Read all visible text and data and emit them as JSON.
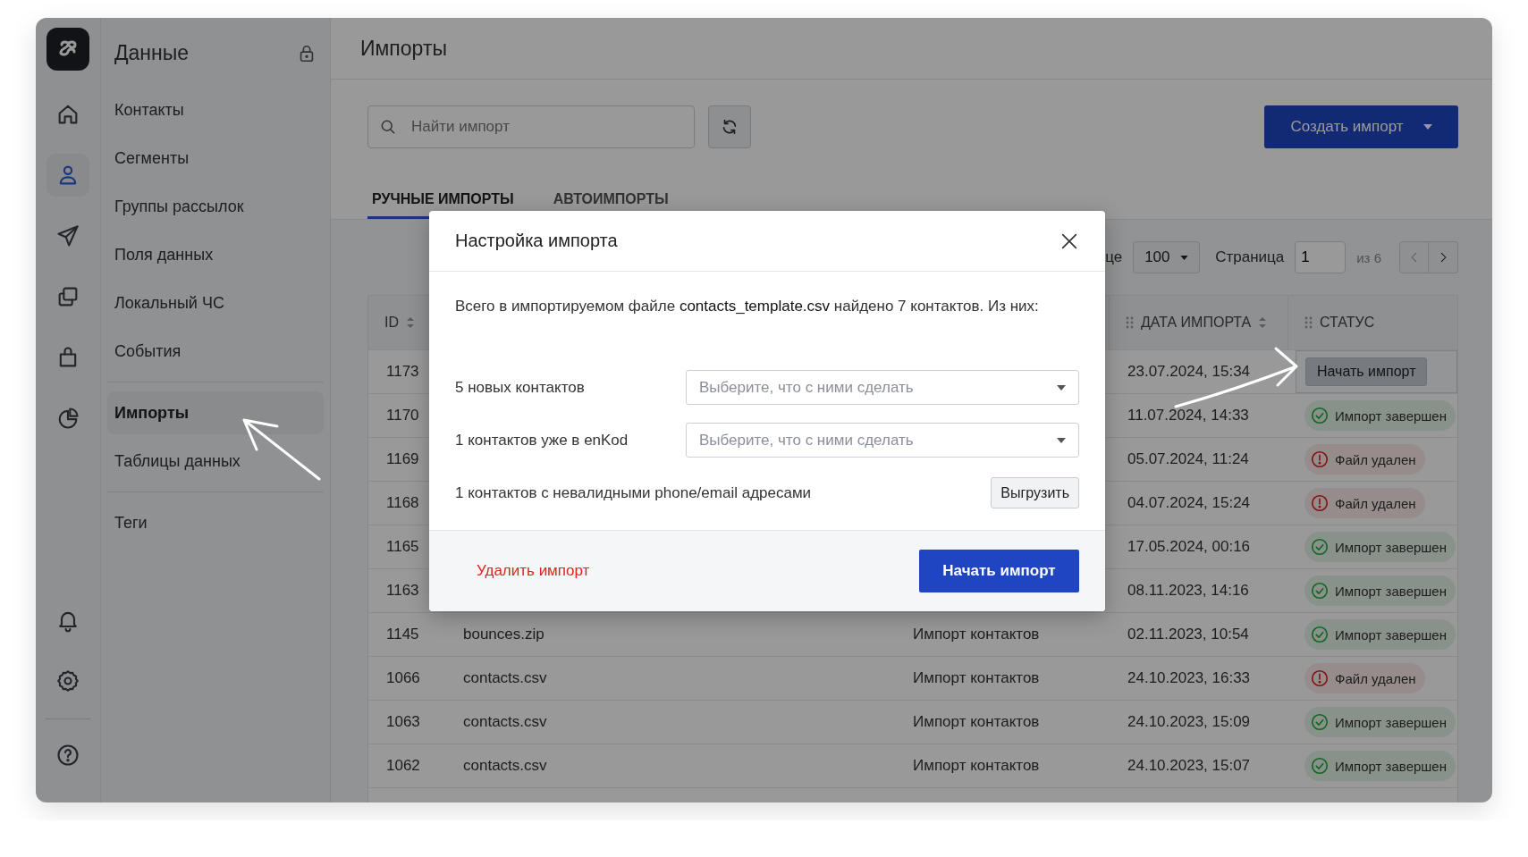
{
  "rail": {
    "top": [
      {
        "kind": "home",
        "selected": false
      },
      {
        "kind": "person",
        "selected": true
      },
      {
        "kind": "send",
        "selected": false
      },
      {
        "kind": "copy",
        "selected": false
      },
      {
        "kind": "bag",
        "selected": false
      },
      {
        "kind": "pie",
        "selected": false
      }
    ],
    "bottom": [
      {
        "kind": "bell",
        "selected": false
      },
      {
        "kind": "gear",
        "selected": false
      },
      {
        "kind": "help",
        "selected": false
      }
    ]
  },
  "sidebar": {
    "title": "Данные",
    "locked": true,
    "groups": [
      [
        {
          "label": "Контакты",
          "selected": false
        },
        {
          "label": "Сегменты",
          "selected": false
        },
        {
          "label": "Группы рассылок",
          "selected": false
        },
        {
          "label": "Поля данных",
          "selected": false
        },
        {
          "label": "Локальный ЧС",
          "selected": false
        },
        {
          "label": "События",
          "selected": false
        }
      ],
      [
        {
          "label": "Импорты",
          "selected": true
        },
        {
          "label": "Таблицы данных",
          "selected": false
        }
      ],
      [
        {
          "label": "Теги",
          "selected": false
        }
      ]
    ]
  },
  "page": {
    "title": "Импорты"
  },
  "toolbar": {
    "search": {
      "placeholder": "Найти импорт"
    },
    "create_button": "Создать импорт"
  },
  "tabs": [
    {
      "label": "РУЧНЫЕ ИМПОРТЫ",
      "selected": true
    },
    {
      "label": "АВТОИМПОРТЫ",
      "selected": false
    }
  ],
  "pagination": {
    "per_page_label": "це",
    "per_page": "100",
    "page_label": "Страница",
    "page": "1",
    "total": "из 6"
  },
  "table": {
    "columns": [
      {
        "label": "ID",
        "sortable": true,
        "draggable": false
      },
      {},
      {},
      {
        "label": "ДАТА ИМПОРТА",
        "sortable": true,
        "draggable": true
      },
      {
        "label": "СТАТУС",
        "sortable": false,
        "draggable": true
      }
    ],
    "rows": [
      {
        "id": "1173",
        "date": "23.07.2024, 15:34",
        "status": {
          "kind": "action",
          "label": "Начать импорт"
        }
      },
      {
        "id": "1170",
        "date": "11.07.2024, 14:33",
        "status": {
          "kind": "done",
          "label": "Импорт завершен"
        }
      },
      {
        "id": "1169",
        "date": "05.07.2024, 11:24",
        "status": {
          "kind": "deleted",
          "label": "Файл удален"
        }
      },
      {
        "id": "1168",
        "date": "04.07.2024, 15:24",
        "status": {
          "kind": "deleted",
          "label": "Файл удален"
        }
      },
      {
        "id": "1165",
        "date": "17.05.2024, 00:16",
        "status": {
          "kind": "done",
          "label": "Импорт завершен"
        }
      },
      {
        "id": "1163",
        "date": "08.11.2023, 14:16",
        "status": {
          "kind": "done",
          "label": "Импорт завершен"
        }
      },
      {
        "id": "1145",
        "file": "bounces.zip",
        "type": "Импорт контактов",
        "date": "02.11.2023, 10:54",
        "status": {
          "kind": "done",
          "label": "Импорт завершен"
        }
      },
      {
        "id": "1066",
        "file": "contacts.csv",
        "type": "Импорт контактов",
        "date": "24.10.2023, 16:33",
        "status": {
          "kind": "deleted",
          "label": "Файл удален"
        }
      },
      {
        "id": "1063",
        "file": "contacts.csv",
        "type": "Импорт контактов",
        "date": "24.10.2023, 15:09",
        "status": {
          "kind": "done",
          "label": "Импорт завершен"
        }
      },
      {
        "id": "1062",
        "file": "contacts.csv",
        "type": "Импорт контактов",
        "date": "24.10.2023, 15:07",
        "status": {
          "kind": "done",
          "label": "Импорт завершен"
        }
      }
    ]
  },
  "dialog": {
    "title": "Настройка импорта",
    "summary": "Всего в импортируемом файле **contacts_template.csv** найдено 7 контактов. Из них:",
    "rows": [
      {
        "kind": "select",
        "label": "5 новых контактов",
        "placeholder": "Выберите, что с ними сделать"
      },
      {
        "kind": "select",
        "label": "1 контактов уже в enKod",
        "placeholder": "Выберите, что с ними сделать"
      },
      {
        "kind": "button",
        "label": "1 контактов с невалидными phone/email адресами",
        "button": "Выгрузить"
      }
    ],
    "delete_link": "Удалить импорт",
    "primary_button": "Начать импорт"
  }
}
